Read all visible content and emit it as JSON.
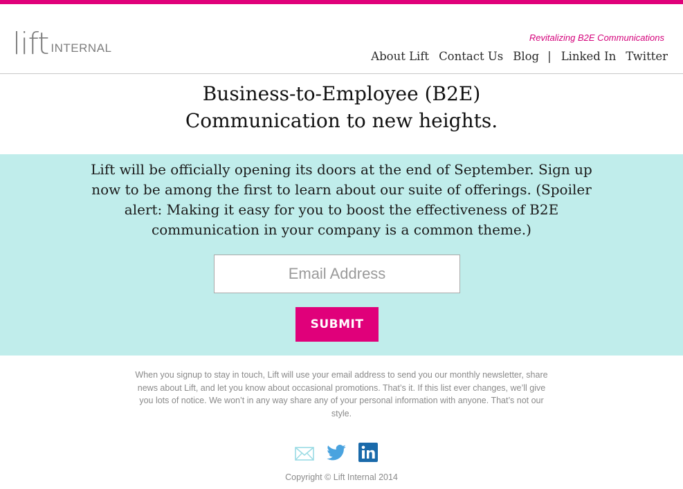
{
  "brand": {
    "logo_word": "lift",
    "logo_sub": "INTERNAL",
    "tagline": "Revitalizing B2E Communications",
    "accent_color": "#e0007a",
    "panel_color": "#c0edeb"
  },
  "nav": {
    "items": [
      "About Lift",
      "Contact Us",
      "Blog",
      "Linked In",
      "Twitter"
    ],
    "separator": "|"
  },
  "hero": {
    "line1": "Business-to-Employee (B2E)",
    "line2": "Communication to new heights."
  },
  "signup": {
    "message": "Lift will be officially opening its doors at the end of September. Sign up now to be among the first to learn about our suite of offerings. (Spoiler alert: Making it easy for you to boost the effectiveness of B2E communication in your company is a common theme.)",
    "email_placeholder": "Email Address",
    "submit_label": "SUBMIT"
  },
  "disclaimer": "When you signup to stay in touch, Lift will use your email address to send you our monthly newsletter, share news about Lift, and let you know about occasional promotions. That’s it. If this list ever changes, we’ll give you lots of notice. We won’t in any way share any of your personal information with anyone. That’s not our style.",
  "social": {
    "icons": [
      "mail-icon",
      "twitter-icon",
      "linkedin-icon"
    ]
  },
  "footer": {
    "copyright": "Copyright © Lift Internal 2014"
  }
}
